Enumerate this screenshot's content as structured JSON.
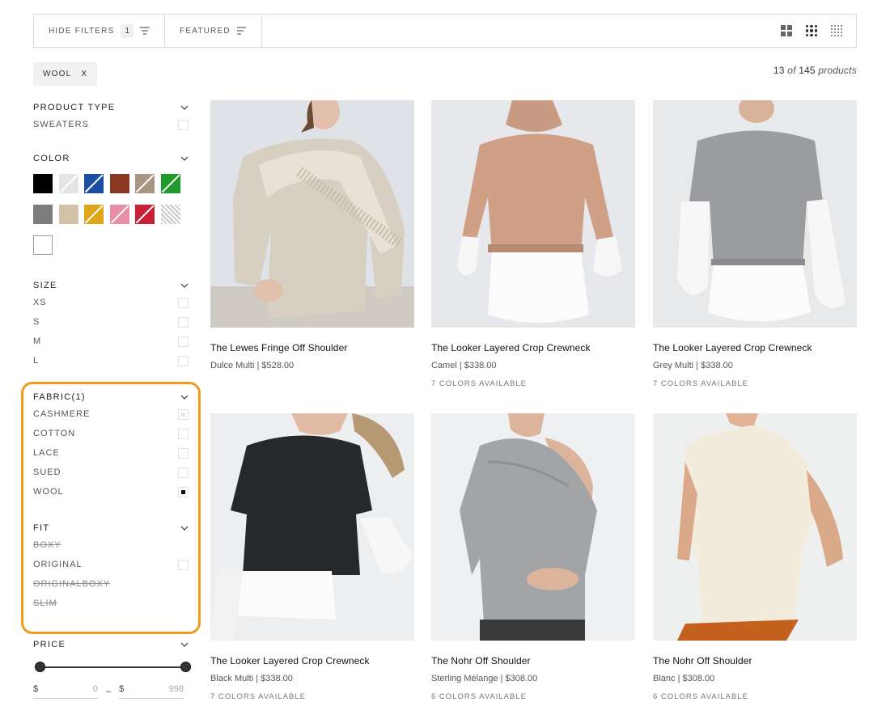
{
  "toolbar": {
    "hide_filters_label": "HIDE FILTERS",
    "filter_count": "1",
    "sort_label": "FEATURED"
  },
  "active_filter": {
    "label": "WOOL",
    "remove": "X"
  },
  "results": {
    "shown": "13",
    "of": "of",
    "total": "145",
    "unit": "products"
  },
  "filters": {
    "product_type": {
      "title": "PRODUCT TYPE",
      "options": [
        {
          "label": "SWEATERS",
          "state": "unchecked"
        }
      ]
    },
    "color": {
      "title": "COLOR",
      "swatches": [
        {
          "name": "black",
          "color": "#000000"
        },
        {
          "name": "white-light",
          "color": "#e5e5e5"
        },
        {
          "name": "blue",
          "color": "#1c4fa3"
        },
        {
          "name": "rust",
          "color": "#8a3a22"
        },
        {
          "name": "taupe",
          "color": "#a89582"
        },
        {
          "name": "green",
          "color": "#1f9b2e"
        },
        {
          "name": "grey",
          "color": "#7c7c7c"
        },
        {
          "name": "beige",
          "color": "#d1c2a8"
        },
        {
          "name": "gold",
          "color": "#e0a51b"
        },
        {
          "name": "pink",
          "color": "#e68fa7"
        },
        {
          "name": "red",
          "color": "#c81f35"
        },
        {
          "name": "pattern",
          "color": "#c8c8c8"
        },
        {
          "name": "white",
          "color": "#ffffff"
        }
      ]
    },
    "size": {
      "title": "SIZE",
      "options": [
        {
          "label": "XS",
          "state": "unchecked"
        },
        {
          "label": "S",
          "state": "unchecked"
        },
        {
          "label": "M",
          "state": "unchecked"
        },
        {
          "label": "L",
          "state": "unchecked"
        }
      ]
    },
    "fabric": {
      "title": "FABRIC(1)",
      "options": [
        {
          "label": "CASHMERE",
          "state": "partial"
        },
        {
          "label": "COTTON",
          "state": "unchecked"
        },
        {
          "label": "LACE",
          "state": "unchecked"
        },
        {
          "label": "SUED",
          "state": "unchecked"
        },
        {
          "label": "WOOL",
          "state": "checked"
        }
      ]
    },
    "fit": {
      "title": "FIT",
      "options": [
        {
          "label": "BOXY",
          "state": "disabled"
        },
        {
          "label": "ORIGINAL",
          "state": "unchecked"
        },
        {
          "label": "ORIGINALBOXY",
          "state": "disabled"
        },
        {
          "label": "SLIM",
          "state": "disabled"
        }
      ]
    },
    "price": {
      "title": "PRICE",
      "currency": "$",
      "min": "0",
      "separator": "–",
      "max": "998"
    }
  },
  "products": [
    {
      "name": "The Lewes Fringe Off Shoulder",
      "price": "Dulce Multi | $528.00",
      "colors": "",
      "image": "fringe-sweater-photo"
    },
    {
      "name": "The Looker Layered Crop Crewneck",
      "price": "Camel | $338.00",
      "colors": "7 COLORS AVAILABLE",
      "image": "camel-crewneck-photo"
    },
    {
      "name": "The Looker Layered Crop Crewneck",
      "price": "Grey Multi | $338.00",
      "colors": "7 COLORS AVAILABLE",
      "image": "grey-crewneck-photo"
    },
    {
      "name": "The Looker Layered Crop Crewneck",
      "price": "Black Multi | $338.00",
      "colors": "7 COLORS AVAILABLE",
      "image": "black-crewneck-photo"
    },
    {
      "name": "The Nohr Off Shoulder",
      "price": "Sterling Mélange | $308.00",
      "colors": "6 COLORS AVAILABLE",
      "image": "grey-off-shoulder-photo"
    },
    {
      "name": "The Nohr Off Shoulder",
      "price": "Blanc | $308.00",
      "colors": "6 COLORS AVAILABLE",
      "image": "cream-off-shoulder-photo"
    }
  ],
  "theme": {
    "accent_highlight": "#f29b1b"
  }
}
